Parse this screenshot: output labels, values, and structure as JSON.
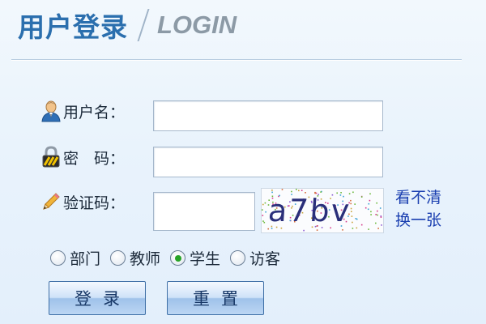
{
  "header": {
    "title_cn": "用户登录",
    "title_en": "LOGIN"
  },
  "form": {
    "username_label": "用户名：",
    "username_value": "",
    "password_label": "密　码：",
    "password_value": "",
    "captcha_label": "验证码：",
    "captcha_value": "",
    "captcha_text": "a7bv",
    "captcha_refresh_line1": "看不清",
    "captcha_refresh_line2": "换一张"
  },
  "roles": {
    "selected": "学生",
    "options": [
      "部门",
      "教师",
      "学生",
      "访客"
    ]
  },
  "buttons": {
    "login": "登录",
    "reset": "重置"
  },
  "colors": {
    "title": "#2b6fae",
    "login_en": "#8c9aa6",
    "link": "#1a3fb0",
    "radio_selected": "#27a327"
  },
  "icons": {
    "username": "user-icon",
    "password": "lock-icon",
    "captcha": "pencil-icon"
  }
}
